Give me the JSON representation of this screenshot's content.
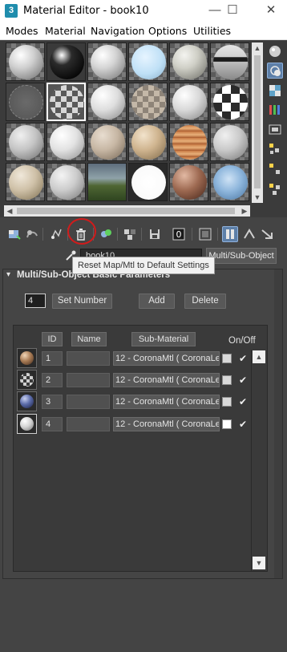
{
  "window": {
    "title": "Material Editor - book10",
    "app_icon": "3",
    "minimize": "—",
    "maximize": "☐",
    "close": "✕"
  },
  "menu": {
    "items": [
      "Modes",
      "Material",
      "Navigation",
      "Options",
      "Utilities"
    ]
  },
  "material_name": {
    "value": "book10",
    "type_button": "Multi/Sub-Object"
  },
  "tooltip": {
    "text": "Reset Map/Mtl to Default Settings"
  },
  "rollout": {
    "title": "Multi/Sub-Object Basic Parameters",
    "collapse": "▾",
    "number_value": "4",
    "set_number": "Set Number",
    "add": "Add",
    "delete": "Delete",
    "headers": {
      "id": "ID",
      "name": "Name",
      "sub_material": "Sub-Material",
      "on_off": "On/Off"
    },
    "rows": [
      {
        "id": "1",
        "sub_material": "12 - CoronaMtl  ( CoronaLe",
        "swatch": "#d9d9d9",
        "enabled": "✔",
        "thumb_icon": "sphere-orange-brown"
      },
      {
        "id": "2",
        "sub_material": "12 - CoronaMtl  ( CoronaLe",
        "swatch": "#d9d9d9",
        "enabled": "✔",
        "thumb_icon": "sphere-dark-checker"
      },
      {
        "id": "3",
        "sub_material": "12 - CoronaMtl  ( CoronaLe",
        "swatch": "#d9d9d9",
        "enabled": "✔",
        "thumb_icon": "sphere-blue-dark"
      },
      {
        "id": "4",
        "sub_material": "12 - CoronaMtl  ( CoronaLe",
        "swatch": "#ffffff",
        "enabled": "✔",
        "thumb_icon": "sphere-white"
      }
    ]
  },
  "scroll": {
    "up": "▲",
    "down": "▼",
    "left": "◀",
    "right": "▶"
  },
  "colors": {
    "accent_active": "#5d7fa8",
    "highlight_circle": "#d11b1b",
    "panel_bg": "#444444"
  }
}
